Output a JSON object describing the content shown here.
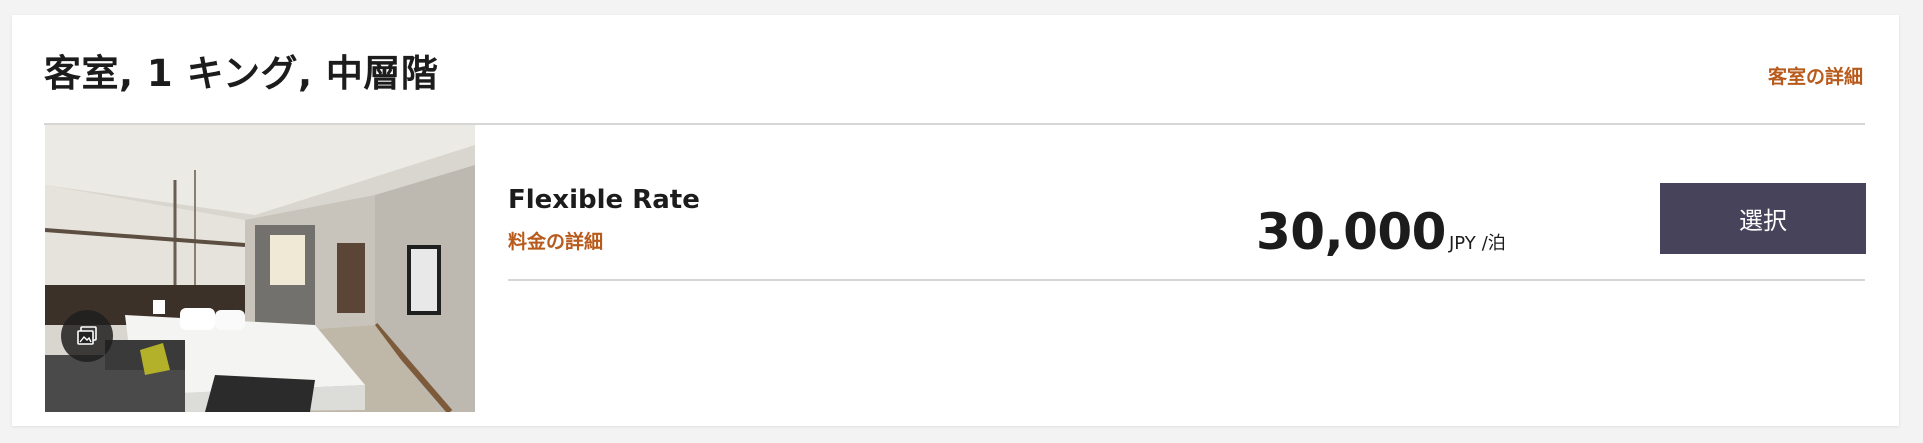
{
  "room": {
    "title": "客室, 1 キング, 中層階",
    "details_link": "客室の詳細"
  },
  "rate": {
    "name": "Flexible Rate",
    "details_link": "料金の詳細",
    "price": "30,000",
    "currency": "JPY",
    "per_night": "/泊",
    "select_label": "選択"
  },
  "colors": {
    "accent_link": "#b85a1b",
    "button_bg": "#47435a"
  },
  "icons": {
    "gallery": "photo-gallery-icon"
  }
}
